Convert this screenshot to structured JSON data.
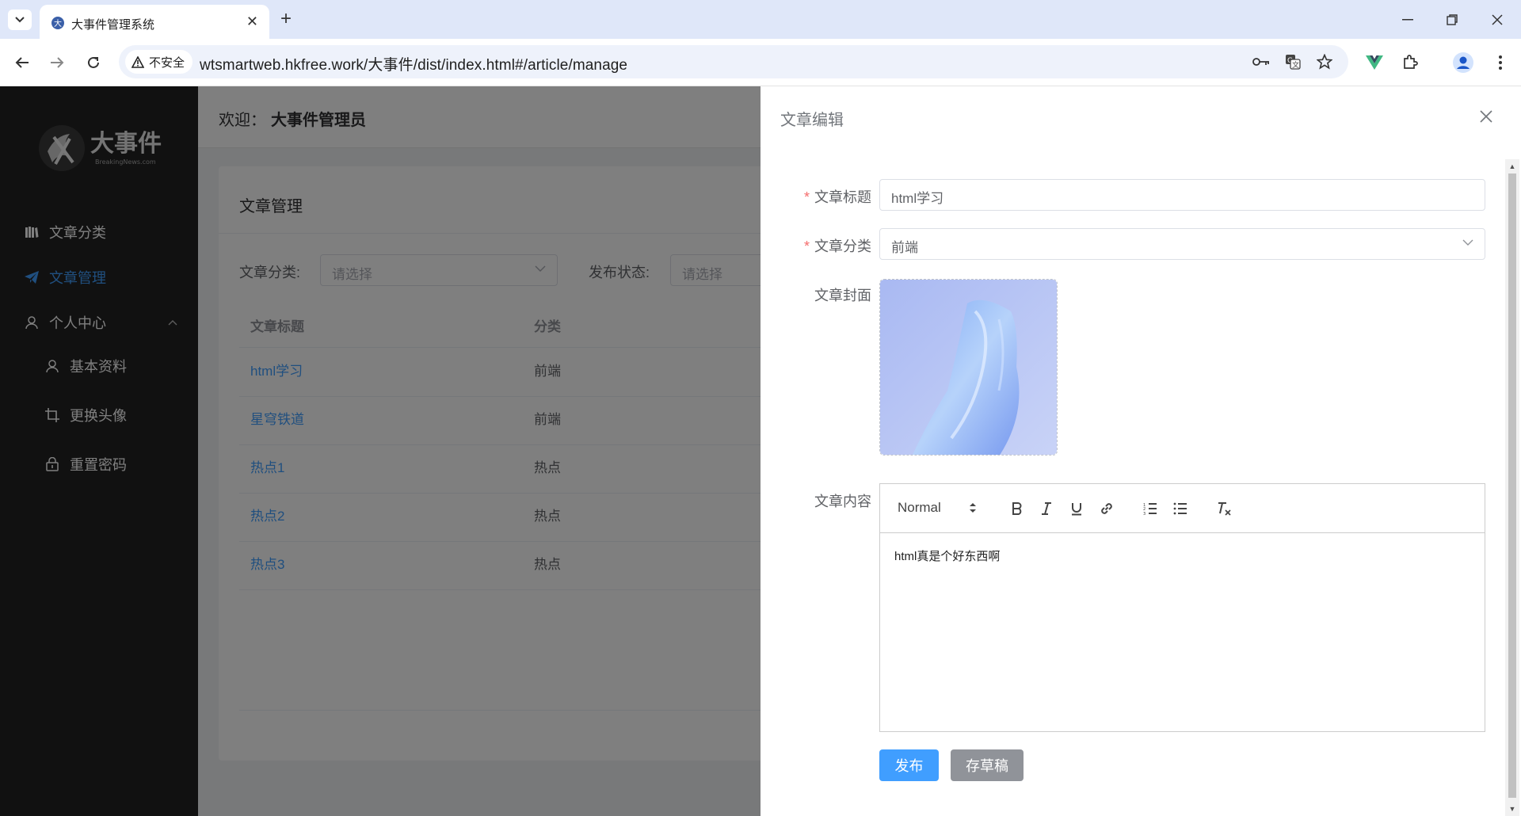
{
  "browser": {
    "tab_title": "大事件管理系统",
    "security_label": "不安全",
    "url": "wtsmartweb.hkfree.work/大事件/dist/index.html#/article/manage"
  },
  "sidebar": {
    "logo_text": "大事件",
    "logo_sub": "BreakingNews.com",
    "items": [
      {
        "label": "文章分类",
        "icon": "book-icon"
      },
      {
        "label": "文章管理",
        "icon": "send-icon"
      },
      {
        "label": "个人中心",
        "icon": "user-icon"
      },
      {
        "label": "基本资料",
        "icon": "user-icon"
      },
      {
        "label": "更换头像",
        "icon": "crop-icon"
      },
      {
        "label": "重置密码",
        "icon": "lock-icon"
      }
    ]
  },
  "header": {
    "welcome_prefix": "欢迎：",
    "username": "大事件管理员"
  },
  "card": {
    "title": "文章管理",
    "filter_category_label": "文章分类:",
    "filter_category_placeholder": "请选择",
    "filter_status_label": "发布状态:",
    "filter_status_placeholder": "请选择",
    "columns": [
      "文章标题",
      "分类"
    ],
    "rows": [
      {
        "title": "html学习",
        "category": "前端"
      },
      {
        "title": "星穹铁道",
        "category": "前端"
      },
      {
        "title": "热点1",
        "category": "热点"
      },
      {
        "title": "热点2",
        "category": "热点"
      },
      {
        "title": "热点3",
        "category": "热点"
      }
    ]
  },
  "drawer": {
    "title": "文章编辑",
    "label_title": "文章标题",
    "value_title": "html学习",
    "label_category": "文章分类",
    "value_category": "前端",
    "label_cover": "文章封面",
    "label_content": "文章内容",
    "heading_select": "Normal",
    "content_text": "html真是个好东西啊",
    "publish_button": "发布",
    "draft_button": "存草稿"
  },
  "colors": {
    "primary": "#409eff",
    "sidebar_bg": "#232323",
    "info": "#909399",
    "required": "#f56c6c"
  }
}
